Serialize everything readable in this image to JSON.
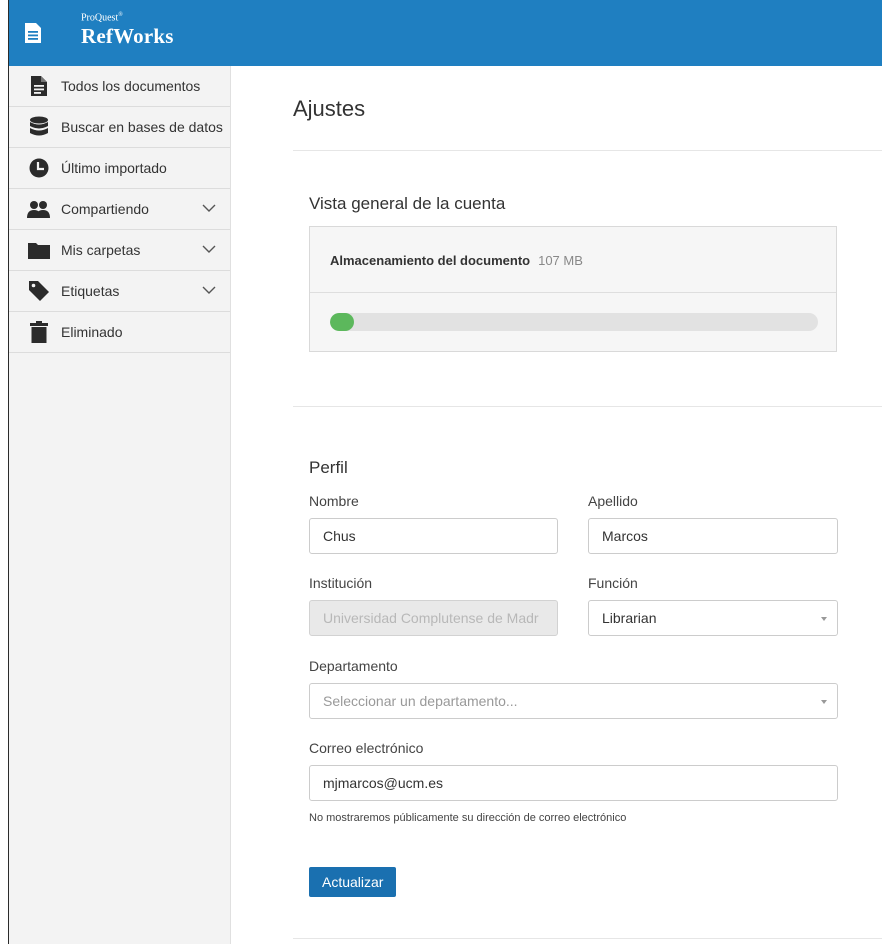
{
  "app": {
    "brand_small": "ProQuest",
    "brand_reg": "®",
    "brand_name": "RefWorks"
  },
  "sidebar": {
    "items": [
      {
        "label": "Todos los documentos",
        "icon": "document-icon",
        "expandable": false
      },
      {
        "label": "Buscar en bases de datos",
        "icon": "database-icon",
        "expandable": false
      },
      {
        "label": "Último importado",
        "icon": "clock-icon",
        "expandable": false
      },
      {
        "label": "Compartiendo",
        "icon": "people-icon",
        "expandable": true
      },
      {
        "label": "Mis carpetas",
        "icon": "folder-icon",
        "expandable": true
      },
      {
        "label": "Etiquetas",
        "icon": "tag-icon",
        "expandable": true
      },
      {
        "label": "Eliminado",
        "icon": "trash-icon",
        "expandable": false
      }
    ]
  },
  "page": {
    "title": "Ajustes"
  },
  "account": {
    "section_title": "Vista general de la cuenta",
    "storage_label": "Almacenamiento del documento",
    "storage_value": "107 MB",
    "storage_fraction": 0.05
  },
  "profile": {
    "section_title": "Perfil",
    "first_name_label": "Nombre",
    "first_name_value": "Chus",
    "last_name_label": "Apellido",
    "last_name_value": "Marcos",
    "institution_label": "Institución",
    "institution_value": "Universidad Complutense de Madr",
    "role_label": "Función",
    "role_value": "Librarian",
    "department_label": "Departamento",
    "department_placeholder": "Seleccionar un departamento...",
    "email_label": "Correo electrónico",
    "email_value": "mjmarcos@ucm.es",
    "email_hint": "No mostraremos públicamente su dirección de correo electrónico",
    "update_button": "Actualizar"
  },
  "colors": {
    "header": "#1f7fc1",
    "button": "#1a70b0",
    "progress": "#5cb85c"
  }
}
